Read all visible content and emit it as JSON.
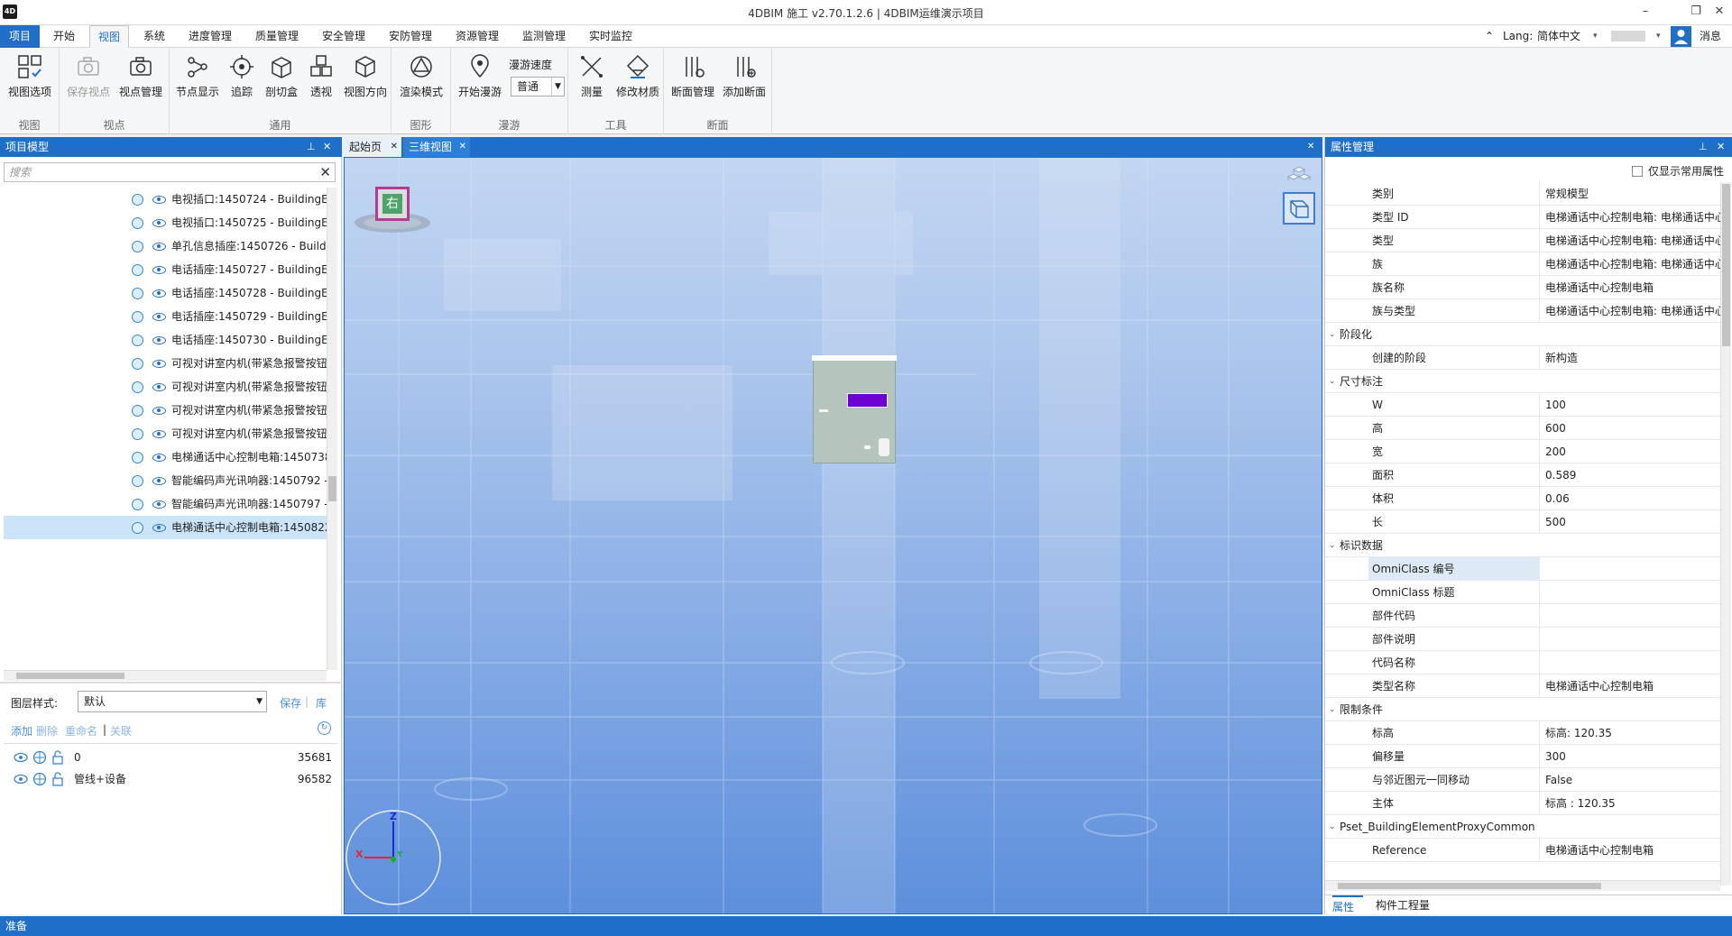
{
  "title": "4DBIM 施工 v2.70.1.2.6 | 4DBIM运维演示项目",
  "app_logo": "4D",
  "menu": {
    "tabs": [
      "项目",
      "开始",
      "视图",
      "系统",
      "进度管理",
      "质量管理",
      "安全管理",
      "安防管理",
      "资源管理",
      "监测管理",
      "实时监控"
    ],
    "lang_label": "Lang:",
    "lang_value": "简体中文",
    "messages": "消息"
  },
  "ribbon": {
    "groups": [
      {
        "label": "视图",
        "buttons": [
          "视图选项"
        ]
      },
      {
        "label": "视点",
        "buttons": [
          "保存视点",
          "视点管理"
        ]
      },
      {
        "label": "通用",
        "buttons": [
          "节点显示",
          "追踪",
          "剖切盒",
          "透视",
          "视图方向"
        ]
      },
      {
        "label": "图形",
        "buttons": [
          "渲染模式"
        ]
      },
      {
        "label": "漫游",
        "buttons": [
          "开始漫游"
        ]
      },
      {
        "label": "工具",
        "buttons": [
          "测量",
          "修改材质"
        ]
      },
      {
        "label": "断面",
        "buttons": [
          "断面管理",
          "添加断面"
        ]
      }
    ],
    "speed_label": "漫游速度",
    "speed_value": "普通"
  },
  "left": {
    "header": "项目模型",
    "search_placeholder": "搜索",
    "tree": [
      "电视插口:1450724 - BuildingEl",
      "电视插口:1450725 - BuildingEl",
      "单孔信息插座:1450726 - Buildi",
      "电话插座:1450727 - BuildingEl",
      "电话插座:1450728 - BuildingEl",
      "电话插座:1450729 - BuildingEl",
      "电话插座:1450730 - BuildingEl",
      "可视对讲室内机(带紧急报警按钮",
      "可视对讲室内机(带紧急报警按钮",
      "可视对讲室内机(带紧急报警按钮",
      "可视对讲室内机(带紧急报警按钮",
      "电梯通话中心控制电箱:1450738",
      "智能编码声光讯响器:1450792 -",
      "智能编码声光讯响器:1450797 -",
      "电梯通话中心控制电箱:1450822"
    ],
    "layer_style_label": "图层样式:",
    "layer_style_value": "默认",
    "save": "保存",
    "library": "库",
    "actions": [
      "添加",
      "删除",
      "重命名",
      "关联"
    ],
    "layers": [
      {
        "name": "0",
        "count": "35681"
      },
      {
        "name": "管线+设备",
        "count": "96582"
      }
    ]
  },
  "viewport": {
    "tabs": [
      "起始页",
      "三维视图"
    ],
    "nav_cube_face": "右",
    "axes": [
      "Z",
      "X",
      "Y"
    ]
  },
  "right": {
    "header": "属性管理",
    "only_common": "仅显示常用属性",
    "rows": [
      {
        "type": "prop",
        "k": "类别",
        "v": "常规模型"
      },
      {
        "type": "prop",
        "k": "类型 ID",
        "v": "电梯通话中心控制电箱: 电梯通话中心控"
      },
      {
        "type": "prop",
        "k": "类型",
        "v": "电梯通话中心控制电箱: 电梯通话中心控"
      },
      {
        "type": "prop",
        "k": "族",
        "v": "电梯通话中心控制电箱: 电梯通话中心控"
      },
      {
        "type": "prop",
        "k": "族名称",
        "v": "电梯通话中心控制电箱"
      },
      {
        "type": "prop",
        "k": "族与类型",
        "v": "电梯通话中心控制电箱: 电梯通话中心控"
      },
      {
        "type": "cat",
        "k": "阶段化",
        "v": ""
      },
      {
        "type": "prop",
        "k": "创建的阶段",
        "v": "新构造"
      },
      {
        "type": "cat",
        "k": "尺寸标注",
        "v": ""
      },
      {
        "type": "prop",
        "k": "W",
        "v": "100"
      },
      {
        "type": "prop",
        "k": "高",
        "v": "600"
      },
      {
        "type": "prop",
        "k": "宽",
        "v": "200"
      },
      {
        "type": "prop",
        "k": "面积",
        "v": "0.589"
      },
      {
        "type": "prop",
        "k": "体积",
        "v": "0.06"
      },
      {
        "type": "prop",
        "k": "长",
        "v": "500"
      },
      {
        "type": "cat",
        "k": "标识数据",
        "v": ""
      },
      {
        "type": "sel",
        "k": "OmniClass 编号",
        "v": ""
      },
      {
        "type": "prop",
        "k": "OmniClass 标题",
        "v": ""
      },
      {
        "type": "prop",
        "k": "部件代码",
        "v": ""
      },
      {
        "type": "prop",
        "k": "部件说明",
        "v": ""
      },
      {
        "type": "prop",
        "k": "代码名称",
        "v": ""
      },
      {
        "type": "prop",
        "k": "类型名称",
        "v": "电梯通话中心控制电箱"
      },
      {
        "type": "cat",
        "k": "限制条件",
        "v": ""
      },
      {
        "type": "prop",
        "k": "标高",
        "v": "标高: 120.35"
      },
      {
        "type": "prop",
        "k": "偏移量",
        "v": "300"
      },
      {
        "type": "prop",
        "k": "与邻近图元一同移动",
        "v": "False"
      },
      {
        "type": "prop",
        "k": "主体",
        "v": "标高 : 120.35"
      },
      {
        "type": "cat",
        "k": "Pset_BuildingElementProxyCommon",
        "v": ""
      },
      {
        "type": "prop",
        "k": "Reference",
        "v": "电梯通话中心控制电箱"
      }
    ],
    "bottom_tabs": [
      "属性",
      "构件工程量"
    ]
  },
  "status": "准备",
  "colors": {
    "accent": "#1f6fc6",
    "selection": "#cce4f7",
    "panel_bg": "#f5f6f7"
  }
}
